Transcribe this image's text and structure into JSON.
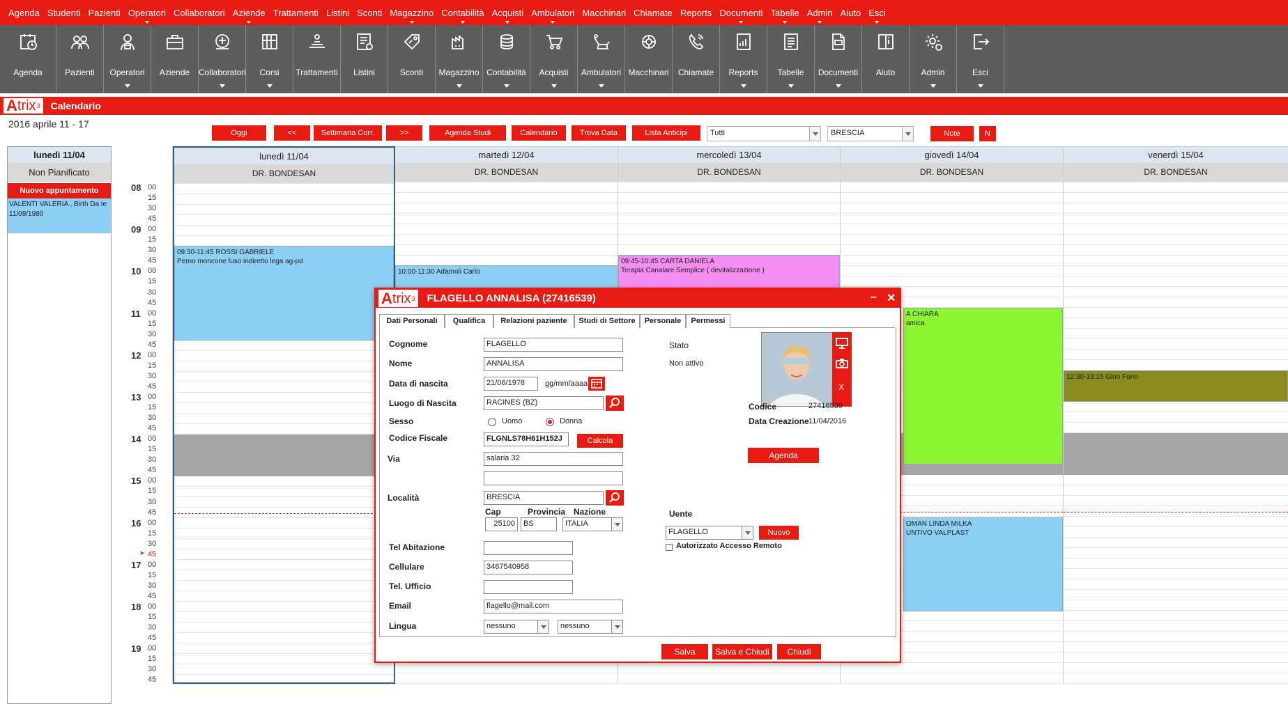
{
  "menu": [
    "Agenda",
    "Studenti",
    "Pazienti",
    "Operatori",
    "Collaboratori",
    "Aziende",
    "Trattamenti",
    "Listini",
    "Sconti",
    "Magazzino",
    "Contabilità",
    "Acquisti",
    "Ambulatori",
    "Macchinari",
    "Chiamate",
    "Reports",
    "Documenti",
    "Tabelle",
    "Admin",
    "Aiuto",
    "Esci"
  ],
  "toolbar": [
    {
      "label": "Agenda",
      "icon": "agenda-icon",
      "arrow": false
    },
    {
      "label": "Pazienti",
      "icon": "patients-icon",
      "arrow": false
    },
    {
      "label": "Operatori",
      "icon": "operator-icon",
      "arrow": true
    },
    {
      "label": "Aziende",
      "icon": "briefcase-icon",
      "arrow": false
    },
    {
      "label": "Collaboratori",
      "icon": "collaborator-icon",
      "arrow": true
    },
    {
      "label": "Corsi",
      "icon": "book-icon",
      "arrow": true
    },
    {
      "label": "Trattamenti",
      "icon": "treatment-icon",
      "arrow": false
    },
    {
      "label": "Listini",
      "icon": "pricelist-icon",
      "arrow": false
    },
    {
      "label": "Sconti",
      "icon": "discount-tag-icon",
      "arrow": false
    },
    {
      "label": "Magazzino",
      "icon": "warehouse-icon",
      "arrow": true
    },
    {
      "label": "Contabilità",
      "icon": "coins-icon",
      "arrow": true
    },
    {
      "label": "Acquisti",
      "icon": "cart-icon",
      "arrow": true
    },
    {
      "label": "Ambulatori",
      "icon": "dental-chair-icon",
      "arrow": true
    },
    {
      "label": "Macchinari",
      "icon": "machine-icon",
      "arrow": false
    },
    {
      "label": "Chiamate",
      "icon": "phone-icon",
      "arrow": false
    },
    {
      "label": "Reports",
      "icon": "report-icon",
      "arrow": true
    },
    {
      "label": "Tabelle",
      "icon": "table-icon",
      "arrow": true
    },
    {
      "label": "Documenti",
      "icon": "document-icon",
      "arrow": true
    },
    {
      "label": "Aiuto",
      "icon": "help-book-icon",
      "arrow": false
    },
    {
      "label": "Admin",
      "icon": "admin-gear-icon",
      "arrow": true
    },
    {
      "label": "Esci",
      "icon": "exit-icon",
      "arrow": true
    }
  ],
  "app": {
    "logo_a": "A",
    "logo_rest": "trix",
    "logo_sup": "3",
    "title": "Calendario",
    "daterange": "2016 aprile 11 - 17"
  },
  "actions": {
    "oggi": "Oggi",
    "prev": "<<",
    "settimana": "Settimana Corr.",
    "next": ">>",
    "agenda_studi": "Agenda Studi",
    "calendario": "Calendario",
    "trova_data": "Trova Data",
    "lista_anticipi": "Lista Anticipi",
    "filter": "Tutti",
    "city": "BRESCIA",
    "note": "Note",
    "n": "N"
  },
  "left": {
    "header": "lunedì 11/04",
    "sub": "Non Pianificato",
    "nuovo": "Nuovo appuntamento",
    "appt": "VALENTI VALERIA , Birth Da te 11/08/1980"
  },
  "hours": [
    "08",
    "09",
    "10",
    "11",
    "12",
    "13",
    "14",
    "15",
    "16",
    "17",
    "18",
    "19"
  ],
  "quarters": [
    "00",
    "15",
    "30",
    "45"
  ],
  "now_marker": "45",
  "days": [
    {
      "name": "lunedì 11/04",
      "doctor": "DR. BONDESAN"
    },
    {
      "name": "martedì 12/04",
      "doctor": "DR. BONDESAN"
    },
    {
      "name": "mercoledì 13/04",
      "doctor": "DR. BONDESAN"
    },
    {
      "name": "giovedì 14/04",
      "doctor": "DR. BONDESAN"
    },
    {
      "name": "venerdì 15/04",
      "doctor": "DR. BONDESAN"
    }
  ],
  "events": [
    {
      "text": "09:30-11:45 ROSSI GABRIELE\nPerno moncone fuso indiretto lega ag-pd",
      "color": "#8ecff5"
    },
    {
      "text": "10:00-11:30 Adamoli Carlo",
      "color": "#8ecff5"
    },
    {
      "text": "09:45-10:45 CARTA DANIELA\nTerapia Canalare Semplice  ( devitalizzazione )",
      "color": "#f58ef2"
    },
    {
      "text": "A CHIARA\namica",
      "color": "#8ef532"
    },
    {
      "text": "12:30-13:15 Gino Furio",
      "color": "#8a8a1e"
    },
    {
      "text": "OMAN LINDA MILKA\nUNTIVO VALPLAST",
      "color": "#8ecff5"
    }
  ],
  "dialog": {
    "title": "FLAGELLO ANNALISA (27416539)",
    "tabs": [
      "Dati Personali",
      "Qualifica",
      "Relazioni paziente",
      "Studi di Settore",
      "Personale",
      "Permessi"
    ],
    "labels": {
      "cognome": "Cognome",
      "nome": "Nome",
      "nascita": "Data di nascita",
      "luogo": "Luogo di Nascita",
      "sesso": "Sesso",
      "cf": "Codice Fiscale",
      "via": "Via",
      "localita": "Località",
      "cap": "Cap",
      "provincia": "Provincia",
      "nazione": "Nazione",
      "tel_ab": "Tel Abitazione",
      "cell": "Cellulare",
      "tel_uff": "Tel. Ufficio",
      "email": "Email",
      "lingua": "Lingua",
      "stato": "Stato",
      "codice": "Codice",
      "data_creazione": "Data Creazione",
      "utente": "Uente",
      "uomo": "Uomo",
      "donna": "Donna",
      "date_fmt": "gg/mm/aaaa",
      "autorizzato": "Autorizzato Accesso Remoto"
    },
    "values": {
      "cognome": "FLAGELLO",
      "nome": "ANNALISA",
      "nascita": "21/06/1978",
      "luogo": "RACINES (BZ)",
      "cf": "FLGNLS78H61H152J",
      "via": "salaria 32",
      "via2": "",
      "localita": "BRESCIA",
      "cap": "25100",
      "provincia": "BS",
      "nazione": "ITALIA",
      "tel_ab": "",
      "cell": "3467540958",
      "tel_uff": "",
      "email": "flagello@mail.com",
      "lingua1": "nessuno",
      "lingua2": "nessuno",
      "stato": "Non attivo",
      "codice": "27416539",
      "data_creazione": "11/04/2016",
      "utente": "FLAGELLO"
    },
    "buttons": {
      "calcola": "Calcola",
      "agenda": "Agenda",
      "nuovo": "Nuovo",
      "salva": "Salva",
      "salva_chiudi": "Salva e Chiudi",
      "chiudi": "Chiudi",
      "photo_close": "X"
    }
  }
}
